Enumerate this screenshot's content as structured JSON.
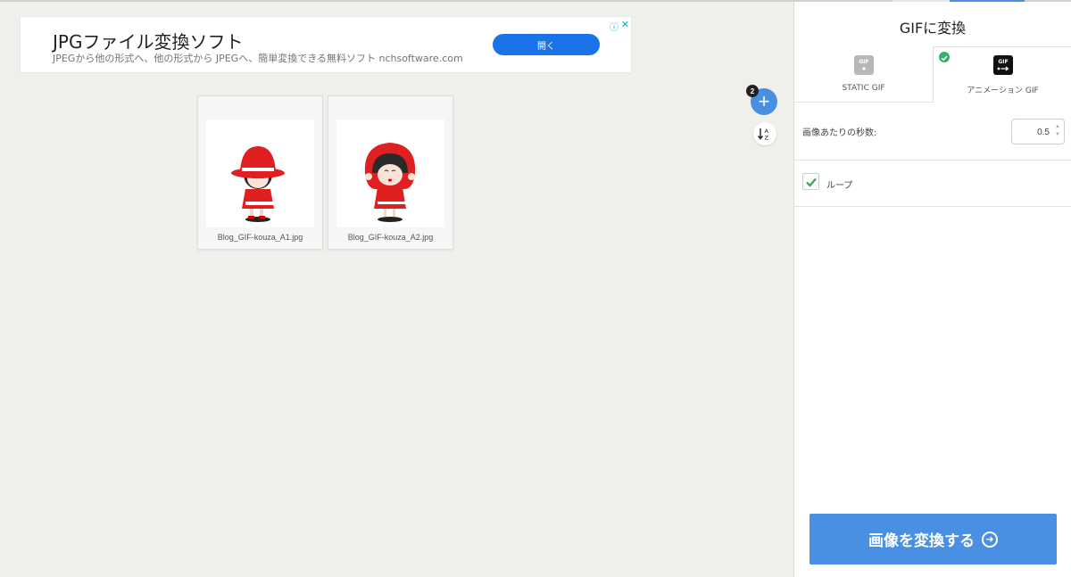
{
  "ad": {
    "title": "JPGファイル変換ソフト",
    "subtitle": "JPEGから他の形式へ、他の形式から JPEGへ、簡単変換できる無料ソフト nchsoftware.com",
    "button_label": "開く"
  },
  "files": {
    "count": "2",
    "items": [
      {
        "name": "Blog_GIF-kouza_A1.jpg"
      },
      {
        "name": "Blog_GIF-kouza_A2.jpg"
      }
    ]
  },
  "panel": {
    "title": "GIFに変換",
    "tabs": [
      {
        "label": "STATIC GIF",
        "icon": "static-gif-icon",
        "selected": false
      },
      {
        "label": "アニメーション GIF",
        "icon": "animated-gif-icon",
        "selected": true
      }
    ],
    "seconds_label": "画像あたりの秒数:",
    "seconds_value": "0.5",
    "loop_label": "ループ",
    "loop_checked": true,
    "convert_label": "画像を変換する"
  },
  "colors": {
    "accent": "#4a90e2",
    "ad_button": "#1a73e8",
    "check": "#35b06a"
  }
}
